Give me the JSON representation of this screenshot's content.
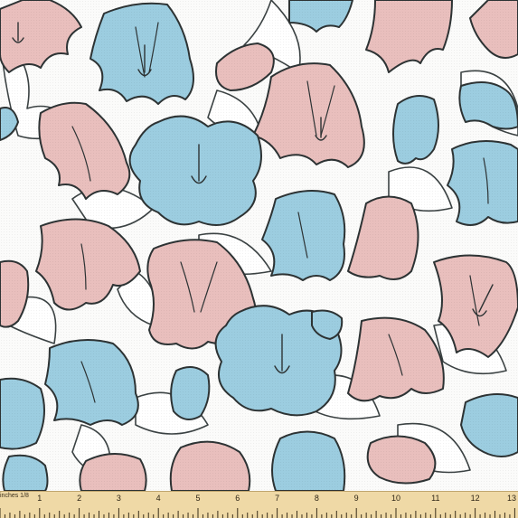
{
  "image": {
    "subject": "bellflower-fabric-swatch",
    "colors": {
      "background": "#ffffff",
      "outline": "#2d3334",
      "pink": "#e9bfbd",
      "blue": "#9ccde0",
      "ruler": "#efd9a6"
    }
  },
  "ruler": {
    "unit_label": "inches 1/8",
    "numbers": [
      "1",
      "2",
      "3",
      "4",
      "5",
      "6",
      "7",
      "8",
      "9",
      "10",
      "11",
      "12",
      "13"
    ]
  }
}
